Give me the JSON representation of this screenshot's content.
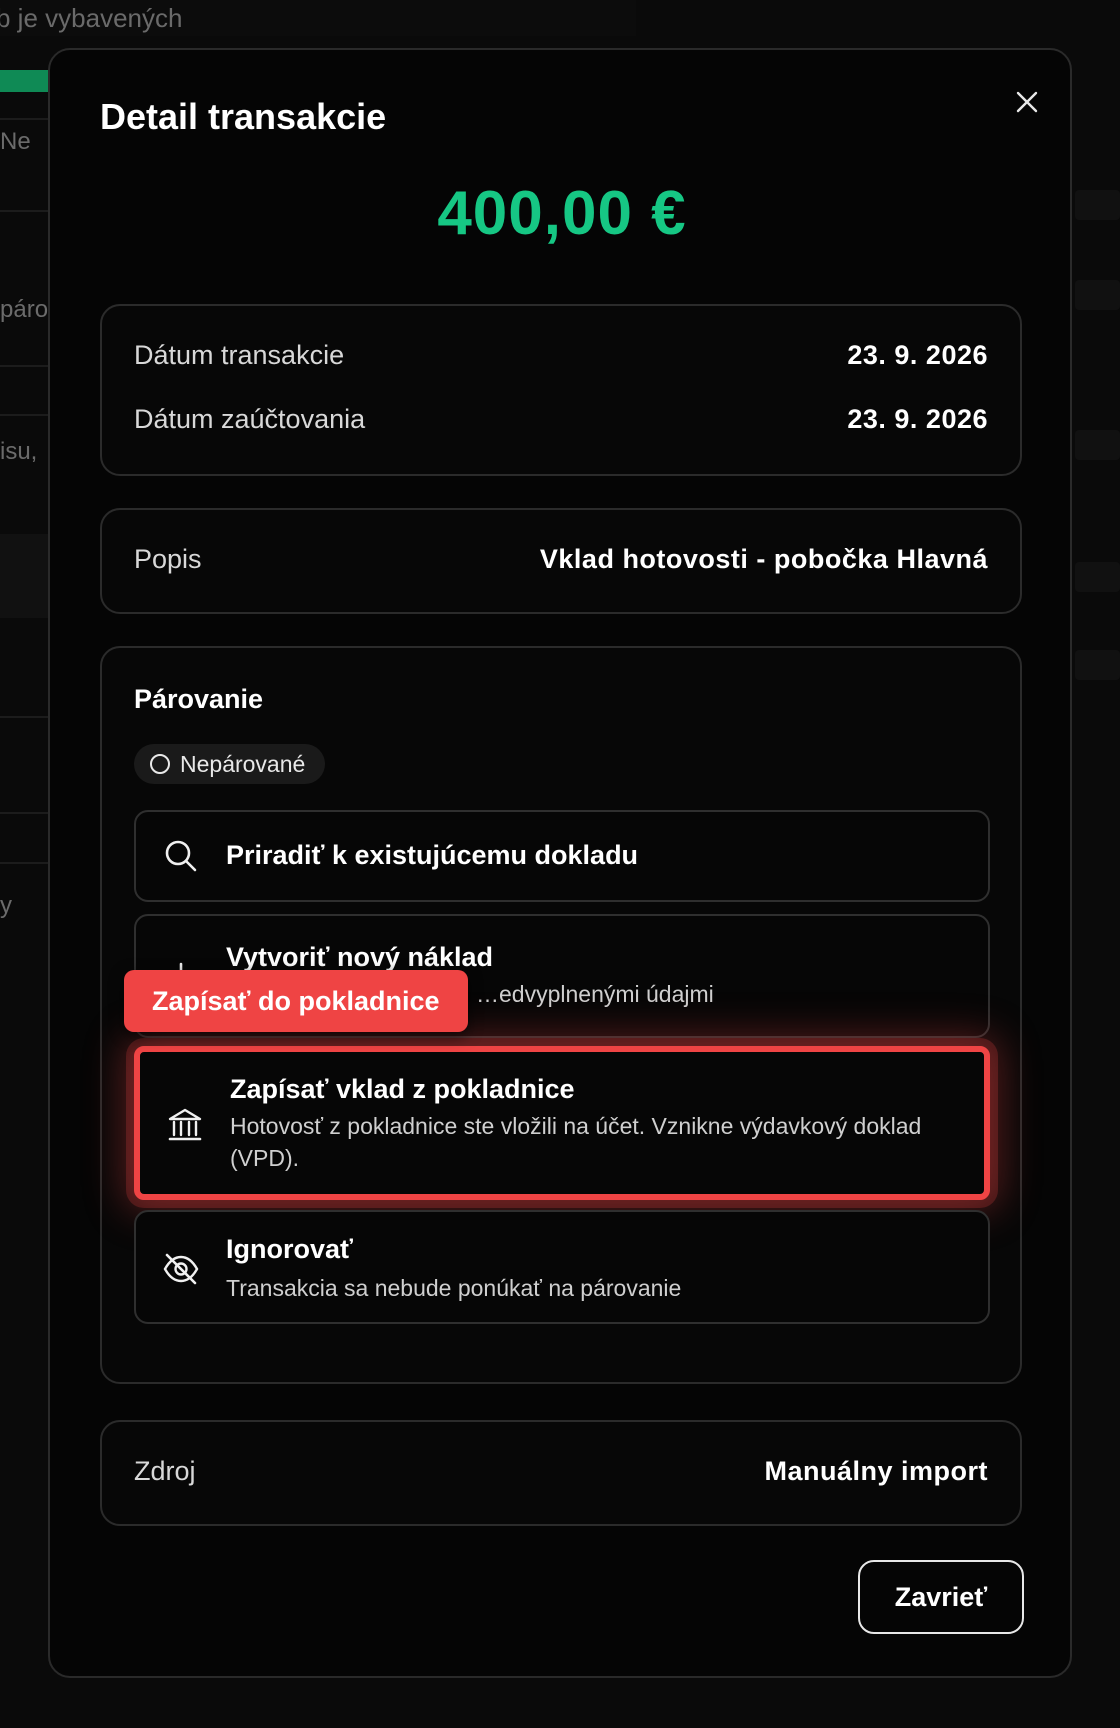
{
  "background": {
    "hint_text": "b je vybavených",
    "row_texts": [
      "Ne",
      "páro",
      "isu,",
      "y"
    ]
  },
  "modal": {
    "title": "Detail transakcie",
    "close_icon": "close-icon",
    "amount": "400,00 €",
    "amount_color": "#16c784",
    "dates": {
      "transaction_label": "Dátum transakcie",
      "transaction_value": "23. 9. 2026",
      "posting_label": "Dátum zaúčtovania",
      "posting_value": "23. 9. 2026"
    },
    "description": {
      "label": "Popis",
      "value": "Vklad hotovosti - pobočka Hlavná"
    },
    "pairing": {
      "title": "Párovanie",
      "status": "Nepárované",
      "options": [
        {
          "icon": "search-icon",
          "title": "Priradiť k existujúcemu dokladu",
          "description": ""
        },
        {
          "icon": "plus-icon",
          "title": "Vytvoriť nový náklad",
          "description": "…edvyplnenými údajmi"
        },
        {
          "icon": "bank-icon",
          "title": "Zapísať vklad z pokladnice",
          "description": "Hotovosť z pokladnice ste vložili na účet. Vznikne výdavkový doklad (VPD)."
        },
        {
          "icon": "eye-off-icon",
          "title": "Ignorovať",
          "description": "Transakcia sa nebude ponúkať na párovanie"
        }
      ]
    },
    "source": {
      "label": "Zdroj",
      "value": "Manuálny import"
    },
    "close_button_label": "Zavrieť"
  },
  "tooltip": {
    "label": "Zapísať do pokladnice",
    "color": "#ef4444"
  }
}
